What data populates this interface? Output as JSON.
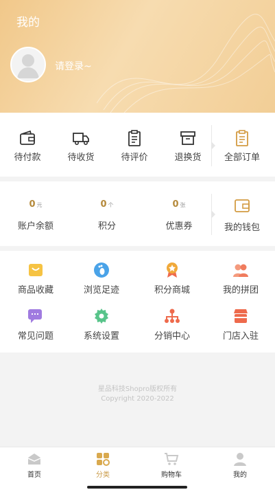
{
  "header": {
    "title": "我的",
    "login_text": "请登录~"
  },
  "orders": {
    "items": [
      {
        "label": "待付款",
        "icon": "wallet-icon"
      },
      {
        "label": "待收货",
        "icon": "truck-icon"
      },
      {
        "label": "待评价",
        "icon": "clipboard-icon"
      },
      {
        "label": "退换货",
        "icon": "box-icon"
      }
    ],
    "all_label": "全部订单"
  },
  "wallet": {
    "items": [
      {
        "value": "0",
        "unit": "元",
        "label": "账户余额"
      },
      {
        "value": "0",
        "unit": "个",
        "label": "积分"
      },
      {
        "value": "0",
        "unit": "张",
        "label": "优惠券"
      }
    ],
    "my_wallet_label": "我的钱包"
  },
  "tools": [
    {
      "label": "商品收藏",
      "icon": "favorites-bag-icon",
      "color": "#f6c343"
    },
    {
      "label": "浏览足迹",
      "icon": "footprint-icon",
      "color": "#4aa3e8"
    },
    {
      "label": "积分商城",
      "icon": "medal-icon",
      "color": "#f0a93a"
    },
    {
      "label": "我的拼团",
      "icon": "group-icon",
      "color": "#f07c5e"
    },
    {
      "label": "常见问题",
      "icon": "faq-chat-icon",
      "color": "#a07be0"
    },
    {
      "label": "系统设置",
      "icon": "settings-gear-icon",
      "color": "#58c48a"
    },
    {
      "label": "分销中心",
      "icon": "distribution-icon",
      "color": "#ee6a4c"
    },
    {
      "label": "门店入驻",
      "icon": "store-icon",
      "color": "#ee6a4c"
    }
  ],
  "footer": {
    "line1": "星品科技Shopro版权所有",
    "line2": "Copyright 2020-2022"
  },
  "tabbar": [
    {
      "label": "首页",
      "icon": "home-icon",
      "active": false
    },
    {
      "label": "分类",
      "icon": "category-icon",
      "active": true
    },
    {
      "label": "购物车",
      "icon": "cart-icon",
      "active": false
    },
    {
      "label": "我的",
      "icon": "user-icon",
      "active": false
    }
  ],
  "colors": {
    "accent": "#c99a46",
    "header": "#f1c88a"
  }
}
